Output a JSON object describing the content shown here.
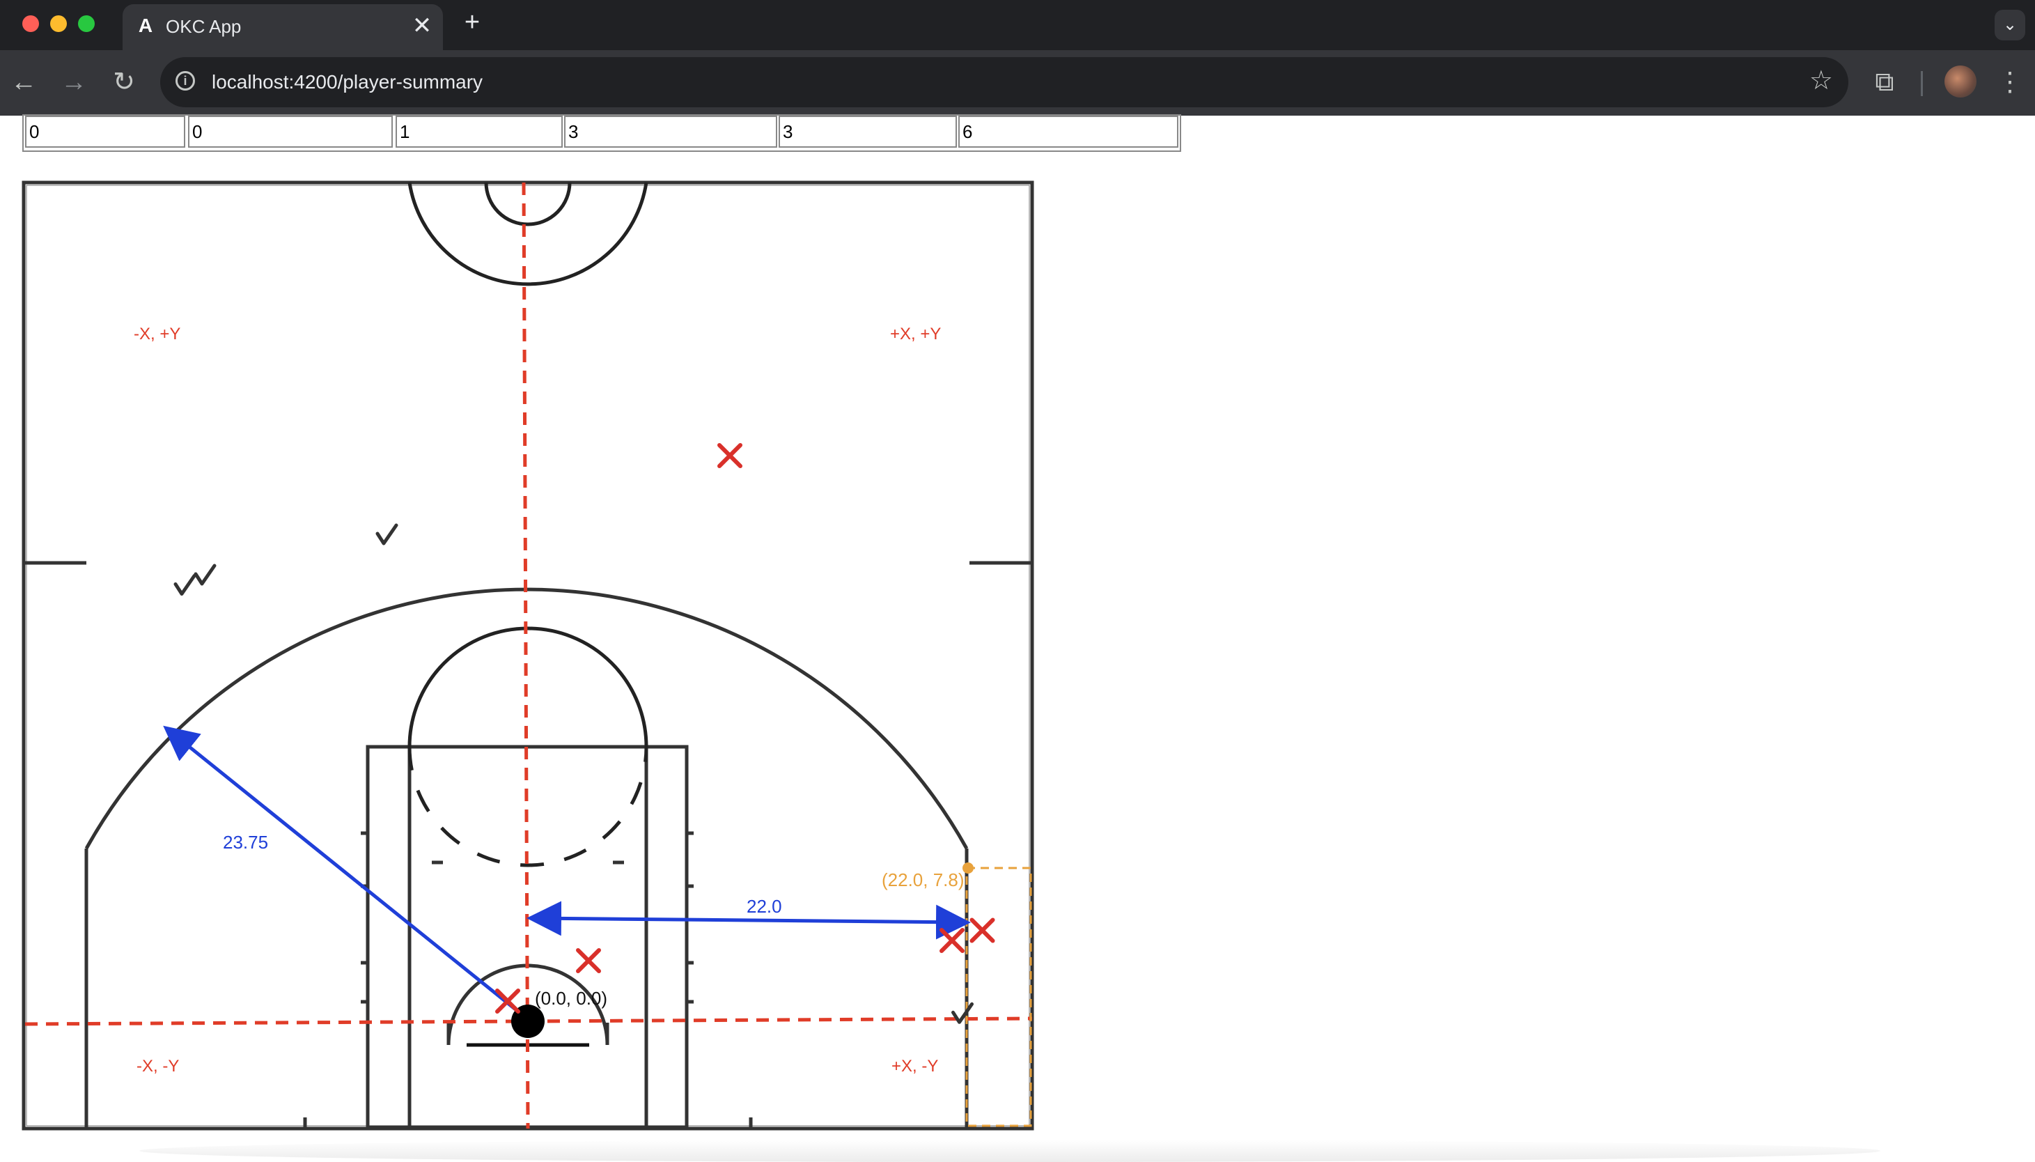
{
  "browser": {
    "tab_title": "OKC App",
    "tab_favicon": "A",
    "close_glyph": "✕",
    "new_tab_glyph": "+",
    "url": "localhost:4200/player-summary",
    "icons": {
      "back": "←",
      "forward": "→",
      "reload": "↻",
      "info": "i",
      "bookmark": "☆",
      "extensions": "⧉",
      "menu": "⋮",
      "tab_search": "⌄"
    }
  },
  "stats_row": [
    "0",
    "0",
    "1",
    "3",
    "3",
    "6"
  ],
  "court": {
    "quadrant_labels": {
      "top_left": "-X, +Y",
      "top_right": "+X, +Y",
      "bottom_left": "-X, -Y",
      "bottom_right": "+X, -Y"
    },
    "origin_label": "(0.0, 0.0)",
    "corner_label": "(22.0, 7.8)",
    "arc_distance_label": "23.75",
    "corner_distance_label": "22.0",
    "shots": [
      {
        "x": 10,
        "y": 28,
        "result": "miss"
      },
      {
        "x": -1,
        "y": 1,
        "result": "miss"
      },
      {
        "x": 3,
        "y": 3,
        "result": "miss"
      },
      {
        "x": 21,
        "y": 4,
        "result": "miss"
      },
      {
        "x": 22.5,
        "y": 4.5,
        "result": "miss"
      },
      {
        "x": -7,
        "y": 24,
        "result": "make"
      },
      {
        "x": -16,
        "y": 22,
        "result": "make"
      },
      {
        "x": -17,
        "y": 21.5,
        "result": "make"
      },
      {
        "x": 21.5,
        "y": 0.3,
        "result": "make"
      }
    ],
    "colors": {
      "axis": "#e03c28",
      "measure": "#1f3fd8",
      "corner": "#e8a23c",
      "miss": "#d9302a",
      "make": "#333333",
      "lines": "#333333"
    },
    "scale": {
      "x_range": [
        -25,
        25
      ],
      "y_range": [
        -5.25,
        41.75
      ]
    }
  }
}
